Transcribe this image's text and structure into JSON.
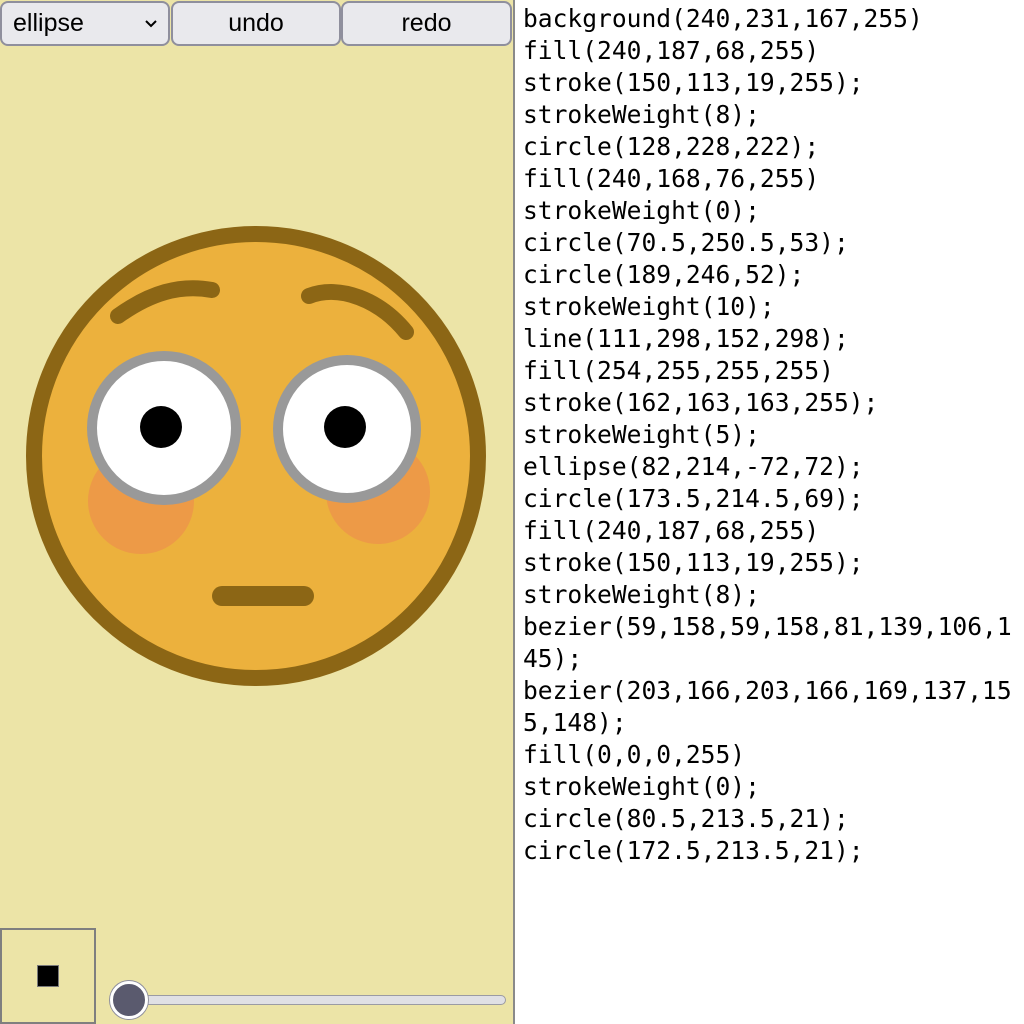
{
  "toolbar": {
    "shape_select": {
      "value": "ellipse",
      "options": [
        "ellipse"
      ],
      "icon": "chevron-down-icon"
    },
    "undo_label": "undo",
    "redo_label": "redo"
  },
  "canvas": {
    "background": "#ece4a7",
    "colors": {
      "face_fill": "#ecb13d",
      "face_stroke": "#8c6615",
      "cheek": "#ed9a47",
      "eye_fill": "#ffffff",
      "eye_stroke": "#999999",
      "pupil": "#000000"
    }
  },
  "current_color": {
    "swatch": "#000000"
  },
  "stroke_slider": {
    "value": 0
  },
  "code": [
    "background(240,231,167,255)",
    "fill(240,187,68,255)",
    "stroke(150,113,19,255);",
    "strokeWeight(8);",
    "circle(128,228,222);",
    "fill(240,168,76,255)",
    "strokeWeight(0);",
    "circle(70.5,250.5,53);",
    "circle(189,246,52);",
    "strokeWeight(10);",
    "line(111,298,152,298);",
    "fill(254,255,255,255)",
    "stroke(162,163,163,255);",
    "strokeWeight(5);",
    "ellipse(82,214,-72,72);",
    "circle(173.5,214.5,69);",
    "fill(240,187,68,255)",
    "stroke(150,113,19,255);",
    "strokeWeight(8);",
    "bezier(59,158,59,158,81,139,106,145);",
    "bezier(203,166,203,166,169,137,155,148);",
    "fill(0,0,0,255)",
    "strokeWeight(0);",
    "circle(80.5,213.5,21);",
    "circle(172.5,213.5,21);"
  ]
}
